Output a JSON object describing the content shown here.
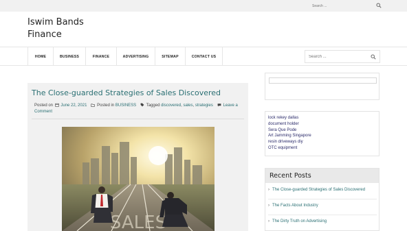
{
  "top_search": {
    "placeholder": "Search ..."
  },
  "site": {
    "title_line1": "Iswim Bands",
    "title_line2": "Finance"
  },
  "nav": {
    "items": [
      {
        "label": "HOME"
      },
      {
        "label": "BUSINESS"
      },
      {
        "label": "FINANCE"
      },
      {
        "label": "ADVERTISING"
      },
      {
        "label": "SITEMAP"
      },
      {
        "label": "CONTACT US"
      }
    ],
    "search_placeholder": "Search ..."
  },
  "post": {
    "title": "The Close-guarded Strategies of Sales Discovered",
    "posted_on_label": "Posted on",
    "date": "June 22, 2021",
    "posted_in_label": "Posted in",
    "category": "BUSINESS",
    "tagged_label": "Tagged",
    "tags": [
      "discovered",
      "sales",
      "strategies"
    ],
    "comment_line1": "Leave a",
    "comment_line2": "Comment",
    "image_text": "SALES"
  },
  "sidebar": {
    "links": [
      "lock rekey dallas",
      "document holder",
      "Sera Que Pode",
      "Art Jamming Singapore",
      "resin driveways diy",
      "OTC equipment"
    ],
    "recent_posts": {
      "title": "Recent Posts",
      "items": [
        "The Close-guarded Strategies of Sales Discovered",
        "The Facts About Industry",
        "The Dirty Truth on Advertising"
      ]
    }
  },
  "colors": {
    "accent": "#2a6f73",
    "link_dark": "#2b2b6a"
  }
}
